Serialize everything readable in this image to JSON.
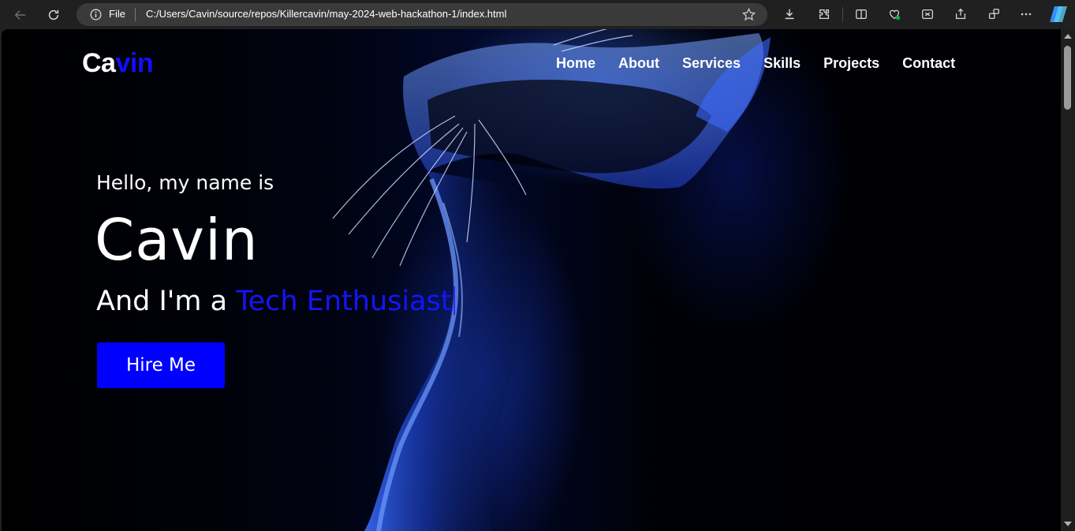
{
  "browser": {
    "file_label": "File",
    "url": "C:/Users/Cavin/source/repos/Killercavin/may-2024-web-hackathon-1/index.html",
    "icons": [
      "back-icon",
      "reload-icon",
      "info-icon",
      "star-icon",
      "download-icon",
      "extensions-icon",
      "split-screen-icon",
      "browser-essentials-icon",
      "screenshot-icon",
      "share-icon",
      "collections-icon",
      "more-icon",
      "copilot-icon"
    ]
  },
  "site": {
    "logo_part1": "Ca",
    "logo_part2": "vin",
    "nav": [
      "Home",
      "About",
      "Services",
      "Skills",
      "Projects",
      "Contact"
    ],
    "hero": {
      "greeting": "Hello, my name is",
      "name": "Cavin",
      "tagline_prefix": "And I'm a ",
      "tagline_highlight": "Tech Enthusiast",
      "cta_label": "Hire Me"
    }
  },
  "colors": {
    "accent": "#0000ff",
    "background": "#000000",
    "chrome": "#202020"
  }
}
